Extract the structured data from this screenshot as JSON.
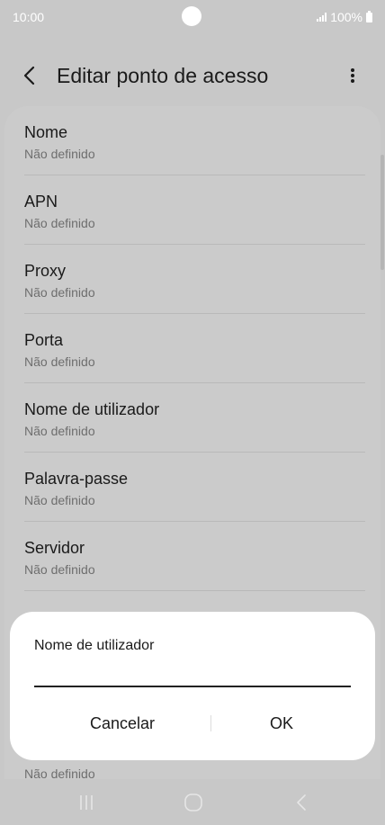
{
  "status_bar": {
    "time": "10:00",
    "battery": "100%",
    "icons": [
      "camera-dot-icon",
      "signal-icon",
      "battery-icon"
    ]
  },
  "app_bar": {
    "title": "Editar ponto de acesso",
    "back_icon": "chevron-left-icon",
    "more_icon": "more-vertical-icon"
  },
  "list": {
    "items": [
      {
        "label": "Nome",
        "value": "Não definido"
      },
      {
        "label": "APN",
        "value": "Não definido"
      },
      {
        "label": "Proxy",
        "value": "Não definido"
      },
      {
        "label": "Porta",
        "value": "Não definido"
      },
      {
        "label": "Nome de utilizador",
        "value": "Não definido"
      },
      {
        "label": "Palavra-passe",
        "value": "Não definido"
      },
      {
        "label": "Servidor",
        "value": "Não definido"
      }
    ],
    "partial_bottom_value": "Não definido"
  },
  "dialog": {
    "title": "Nome de utilizador",
    "input_value": "",
    "cancel_label": "Cancelar",
    "ok_label": "OK"
  },
  "nav_bar": {
    "icons": [
      "recent-apps-icon",
      "home-icon",
      "back-icon"
    ]
  },
  "colors": {
    "scrim_background": "#c8c8c8",
    "dialog_background": "#ffffff",
    "secondary_text": "#6e6e6e"
  }
}
